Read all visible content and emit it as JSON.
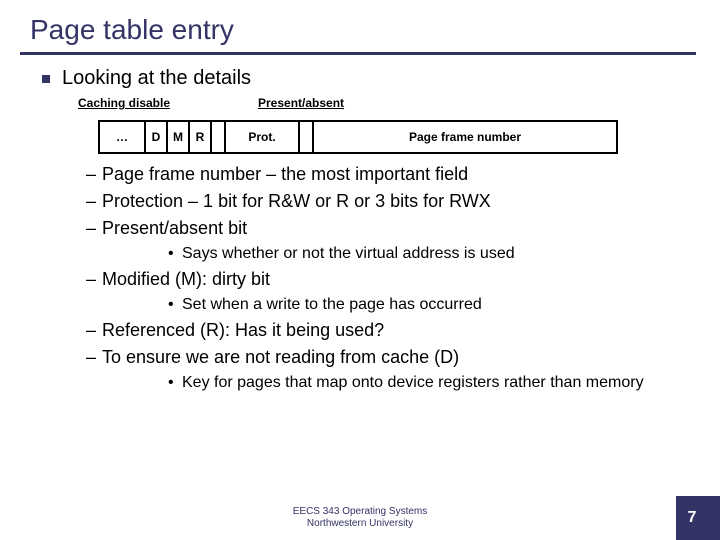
{
  "title": "Page table entry",
  "bullet": "Looking at the details",
  "labels": {
    "cache": "Caching disable",
    "pa": "Present/absent"
  },
  "cells": {
    "dots": "…",
    "d": "D",
    "m": "M",
    "r": "R",
    "prot": "Prot.",
    "pfn": "Page frame number"
  },
  "items": [
    "Page frame number – the most important field",
    "Protection – 1 bit for R&W or R or 3 bits for RWX",
    "Present/absent bit"
  ],
  "sub_pa": "Says whether or not the virtual address is used",
  "item_m": "Modified (M): dirty bit",
  "sub_m": "Set when a write to the page has occurred",
  "item_r": "Referenced (R): Has it being used?",
  "item_d": "To ensure we are not reading from cache (D)",
  "sub_d": "Key for pages that map onto device registers rather than memory",
  "footer1": "EECS 343 Operating Systems",
  "footer2": "Northwestern University",
  "page": "7"
}
